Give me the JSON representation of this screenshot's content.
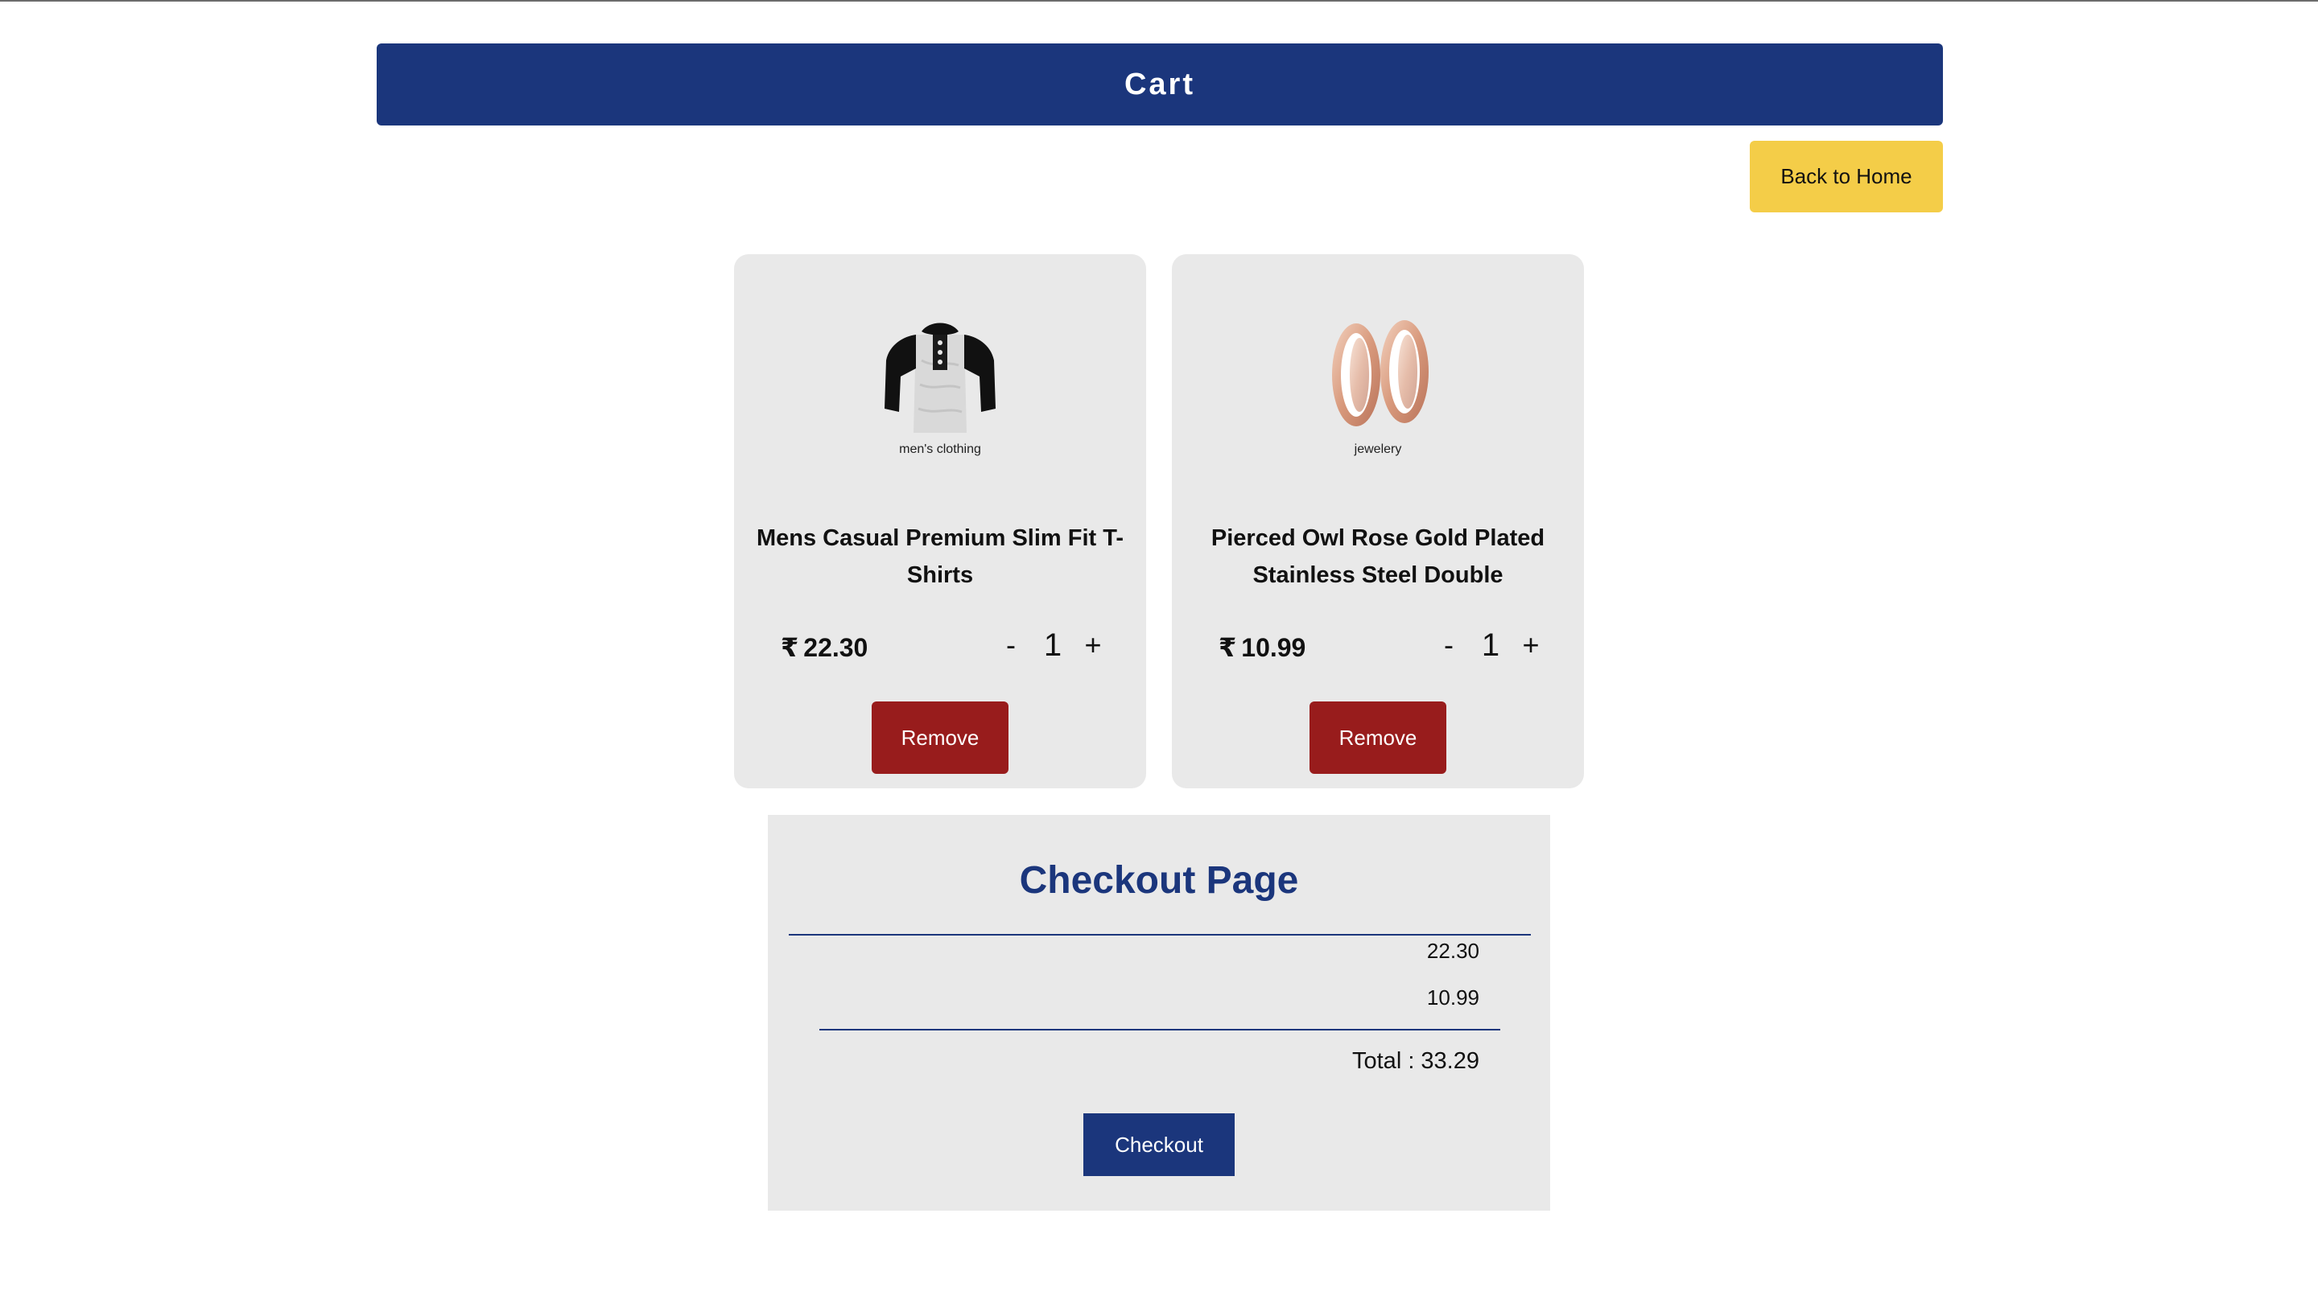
{
  "header": {
    "title": "Cart"
  },
  "nav": {
    "back_label": "Back to Home"
  },
  "cart": {
    "currency_symbol": "₹",
    "items": [
      {
        "category": "men's clothing",
        "title": "Mens Casual Premium Slim Fit T-Shirts",
        "price": "22.30",
        "qty_minus": "-",
        "quantity": "1",
        "qty_plus": "+",
        "remove_label": "Remove",
        "image_icon": "raglan-henley-tshirt-image"
      },
      {
        "category": "jewelery",
        "title": "Pierced Owl Rose Gold Plated Stainless Steel Double",
        "price": "10.99",
        "qty_minus": "-",
        "quantity": "1",
        "qty_plus": "+",
        "remove_label": "Remove",
        "image_icon": "rose-gold-tunnel-plugs-image"
      }
    ]
  },
  "checkout": {
    "title": "Checkout Page",
    "line_amounts": [
      "22.30",
      "10.99"
    ],
    "total_text": "Total : 33.29",
    "button_label": "Checkout"
  },
  "colors": {
    "primary": "#1b367c",
    "accent": "#f4cd48",
    "danger": "#981c1c",
    "panel": "#e9e9e9"
  }
}
